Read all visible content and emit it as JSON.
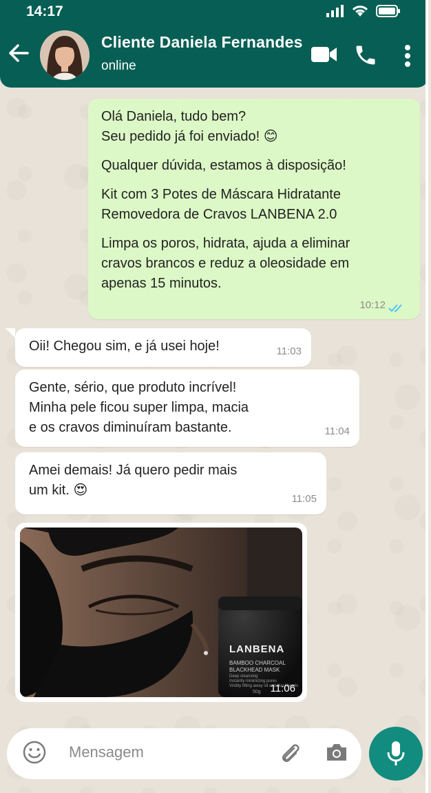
{
  "status_bar": {
    "time": "14:17"
  },
  "header": {
    "title": "Cliente Daniela Fernandes",
    "status": "online"
  },
  "messages": [
    {
      "direction": "out",
      "paragraphs": [
        "Olá Daniela, tudo bem?",
        "Seu pedido já foi enviado! 😊",
        "Qualquer dúvida, estamos à disposição!",
        "Kit com 3 Potes de Máscara Hidratante",
        "Removedora de Cravos LANBENA 2.0",
        "Limpa os poros, hidrata, ajuda a eliminar",
        "cravos brancos e reduz a oleosidade em",
        "apenas 15 minutos."
      ],
      "time": "10:12"
    },
    {
      "direction": "in",
      "text": "Oii! Chegou sim, e já usei hoje!",
      "time": "11:03"
    },
    {
      "direction": "in",
      "lines": [
        "Gente, sério, que produto incrível!",
        "Minha pele ficou super limpa, macia",
        "e os cravos diminuíram bastante."
      ],
      "time": "11:04"
    },
    {
      "direction": "in",
      "lines": [
        "Amei demais! Já quero pedir mais",
        "um kit. 😍"
      ],
      "time": "11:05"
    },
    {
      "direction": "in",
      "type": "image",
      "product_label": {
        "brand": "LANBENA",
        "line1": "BAMBOO CHARCOAL",
        "line2": "BLACKHEAD MASK",
        "small": [
          "Deep cleansing",
          "Instantly minimizing pores",
          "Visibly lifting away oil and blackheads"
        ],
        "weight": "50g"
      },
      "time": "11:06"
    }
  ],
  "input": {
    "placeholder": "Mensagem"
  },
  "colors": {
    "header": "#075e54",
    "outgoing": "#dcf8c6",
    "incoming": "#ffffff",
    "mic": "#128c7e",
    "read_ticks": "#4fc3f7"
  }
}
